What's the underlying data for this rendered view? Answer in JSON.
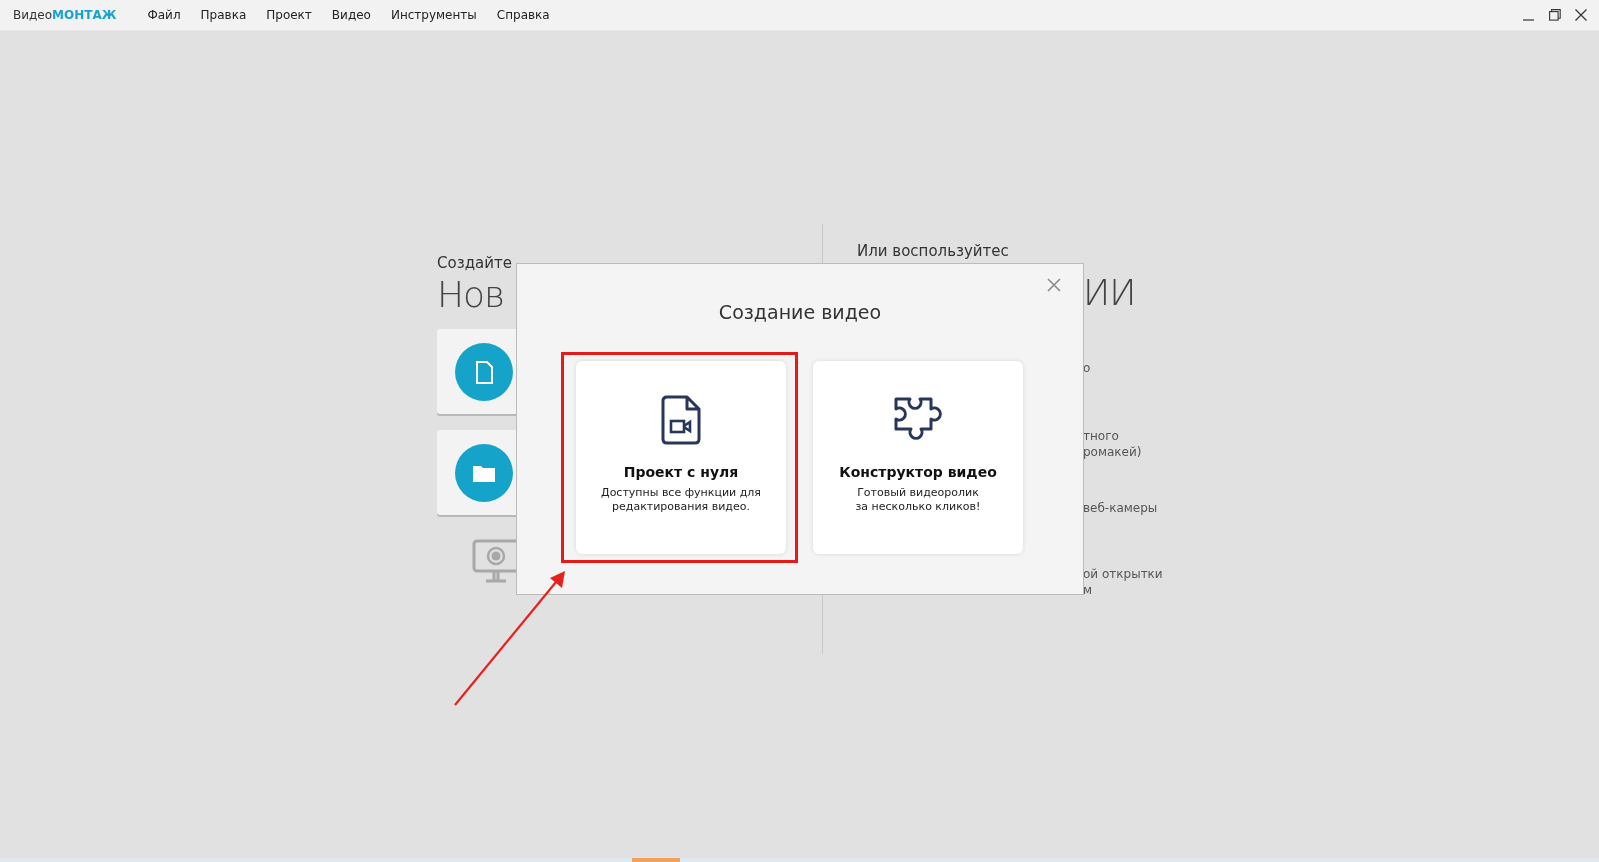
{
  "app": {
    "logo": [
      "Видео",
      "МОНТАЖ"
    ]
  },
  "menu": [
    "Файл",
    "Правка",
    "Проект",
    "Видео",
    "Инструменты",
    "Справка"
  ],
  "background": {
    "left": {
      "caption": "Создайте",
      "heading": "Нов"
    },
    "right": {
      "caption": "Или воспользуйтес",
      "heading": "ИИ",
      "fragments": [
        {
          "lines": [
            "о"
          ]
        },
        {
          "lines": [
            "тного",
            "ромакей)"
          ]
        },
        {
          "lines": [
            "веб-камеры"
          ]
        },
        {
          "lines": [
            "ой открытки",
            "м"
          ]
        }
      ]
    }
  },
  "dialog": {
    "title": "Создание видео",
    "cards": [
      {
        "kind": "file-video",
        "title": "Проект с нуля",
        "description": [
          "Доступны все функции для",
          "редактирования видео."
        ],
        "selected": true
      },
      {
        "kind": "puzzle",
        "title": "Конструктор видео",
        "description": [
          "Готовый видеоролик",
          "за несколько кликов!"
        ],
        "selected": false
      }
    ]
  }
}
